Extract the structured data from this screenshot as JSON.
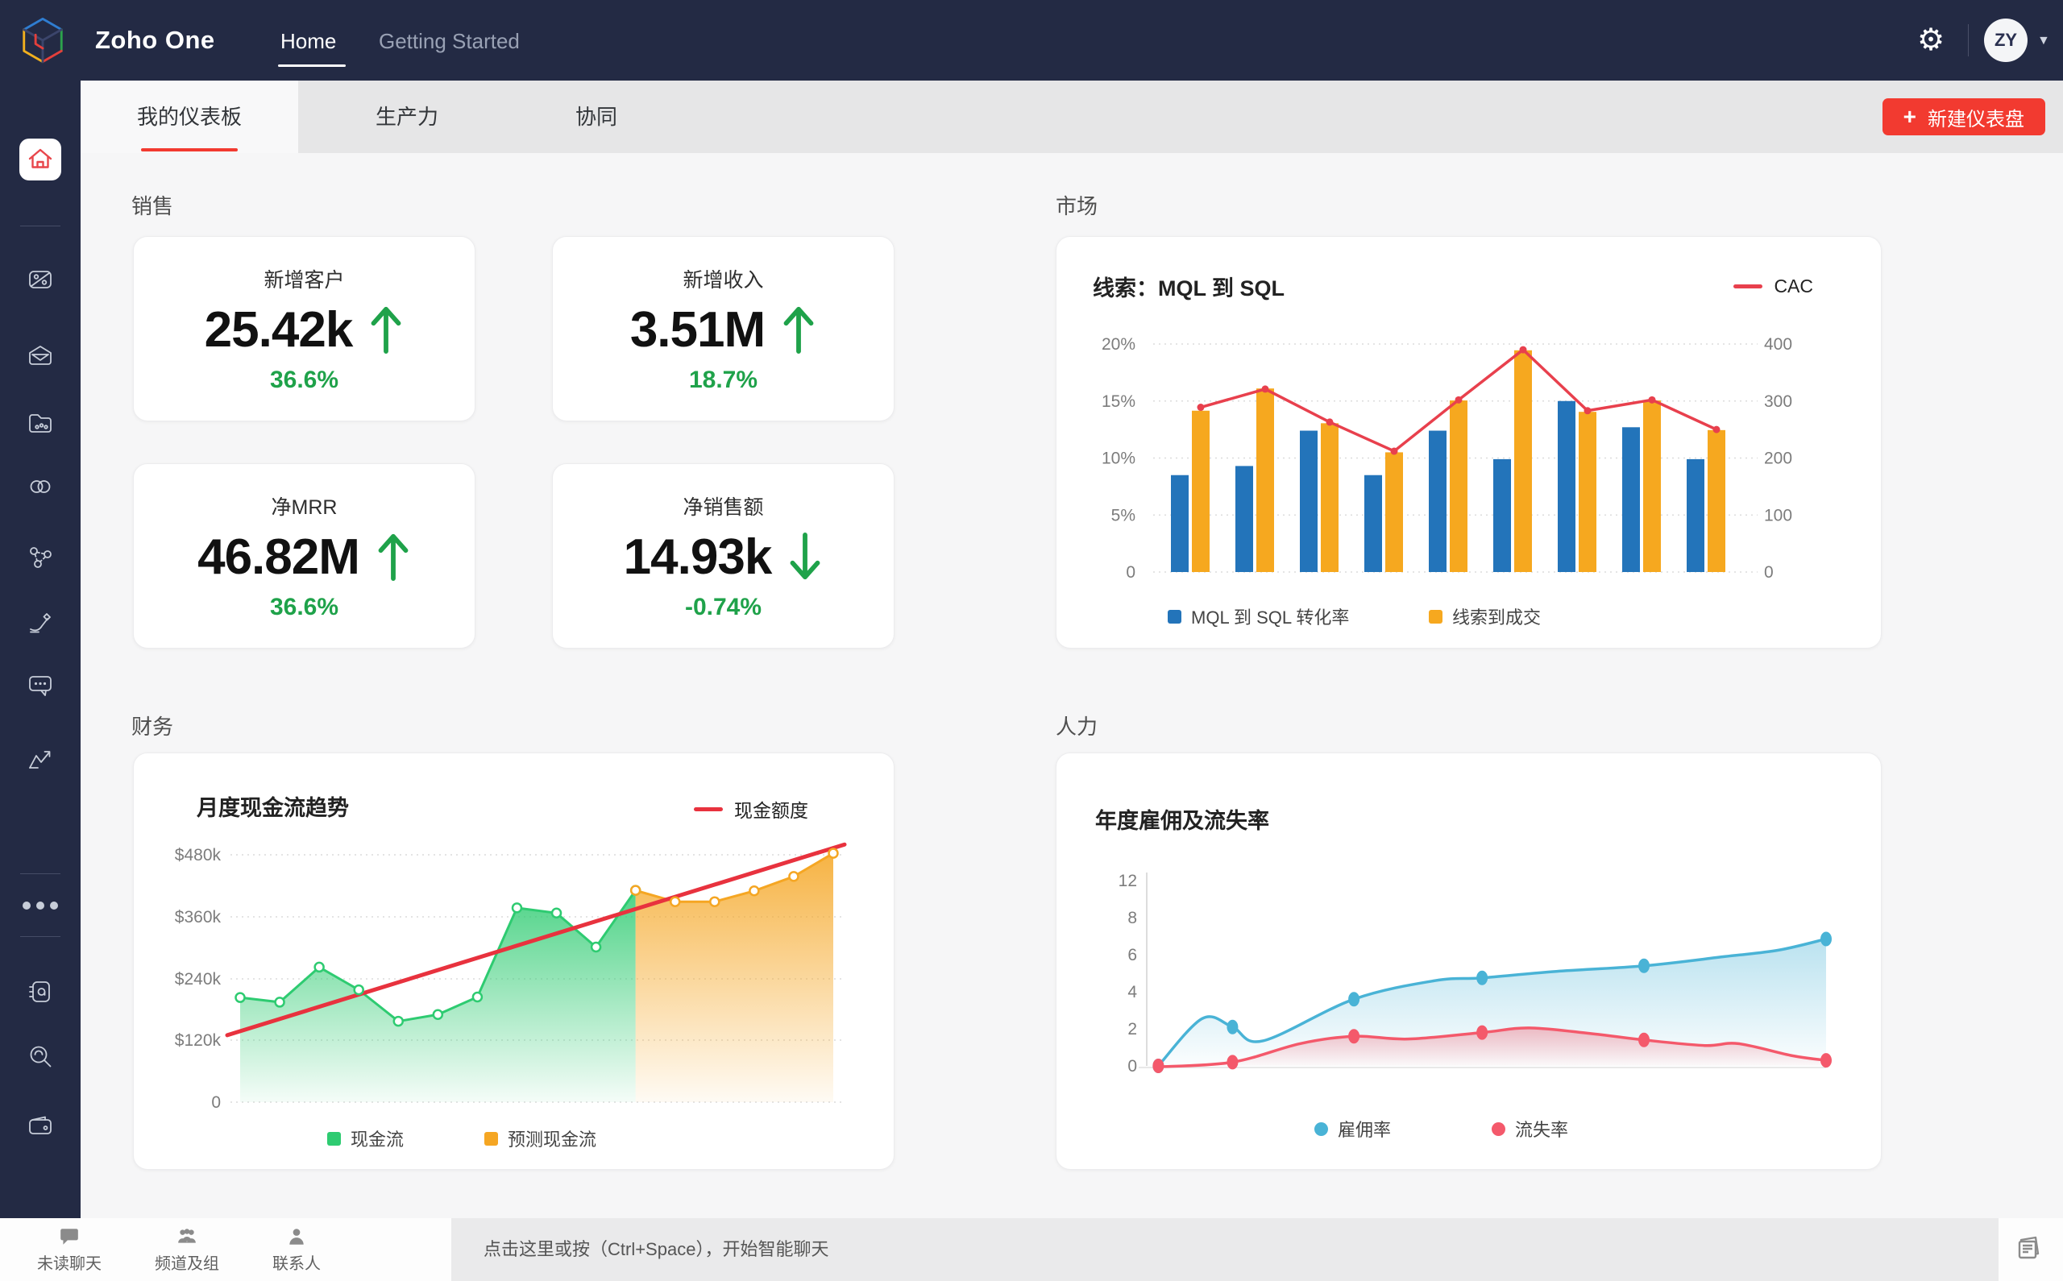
{
  "topbar": {
    "brand": "Zoho One",
    "nav": [
      {
        "label": "Home",
        "active": true
      },
      {
        "label": "Getting Started",
        "active": false
      }
    ],
    "avatar_initials": "ZY",
    "gear_icon": "gear-icon",
    "colors": {
      "bar_bg": "#232a44"
    }
  },
  "sidebar": {
    "items": [
      "home",
      "crm",
      "mail",
      "workdrive",
      "connections",
      "social",
      "sign",
      "cliq",
      "analytics",
      "more",
      "notebook",
      "search",
      "wallet"
    ]
  },
  "tabs": {
    "items": [
      "我的仪表板",
      "生产力",
      "协同"
    ],
    "active_index": 0,
    "new_button": {
      "plus": "+",
      "label": "新建仪表盘",
      "color": "#f23a30"
    }
  },
  "sections": {
    "sales": "销售",
    "market": "市场",
    "finance": "财务",
    "hr": "人力"
  },
  "kpis": [
    {
      "title": "新增客户",
      "value": "25.42k",
      "direction": "up",
      "change": "36.6%"
    },
    {
      "title": "新增收入",
      "value": "3.51M",
      "direction": "up",
      "change": "18.7%"
    },
    {
      "title": "净MRR",
      "value": "46.82M",
      "direction": "up",
      "change": "36.6%"
    },
    {
      "title": "净销售额",
      "value": "14.93k",
      "direction": "down",
      "change": "-0.74%"
    }
  ],
  "kpi_accent_color": "#1fa24a",
  "chart_data": [
    {
      "id": "market",
      "type": "bar",
      "title": "线索：MQL 到 SQL",
      "legend_line": "CAC",
      "left_axis": {
        "ticks": [
          "20%",
          "15%",
          "10%",
          "5%",
          "0"
        ],
        "max": 20
      },
      "right_axis": {
        "ticks": [
          "400",
          "300",
          "200",
          "100",
          "0"
        ],
        "max": 400
      },
      "grid": true,
      "legend_position": "bottom",
      "series": [
        {
          "name": "MQL 到 SQL 转化率",
          "type": "bar",
          "axis": "left",
          "color": "#2374ba",
          "values": [
            8.5,
            9.3,
            12.4,
            8.5,
            12.4,
            9.9,
            15.0,
            12.7,
            9.9
          ]
        },
        {
          "name": "线索到成交",
          "type": "bar",
          "axis": "right",
          "color": "#f6a81f",
          "values": [
            283,
            322,
            261,
            210,
            301,
            389,
            281,
            301,
            249
          ]
        },
        {
          "name": "CAC",
          "type": "line",
          "axis": "right",
          "color": "#e8404d",
          "values": [
            289,
            321,
            263,
            212,
            302,
            390,
            283,
            302,
            250
          ]
        }
      ]
    },
    {
      "id": "finance",
      "type": "area",
      "title": "月度现金流趋势",
      "legend_line": "现金额度",
      "y_ticks": [
        "$480k",
        "$360k",
        "$240k",
        "$120k",
        "0"
      ],
      "ylim": [
        0,
        520
      ],
      "grid": true,
      "legend_position": "bottom",
      "x_slots": 16,
      "series": [
        {
          "name": "现金流",
          "type": "area",
          "color": "#2ecb71",
          "x_start": 0,
          "values": [
            203,
            194,
            262,
            218,
            157,
            170,
            204,
            377,
            367,
            301,
            411
          ]
        },
        {
          "name": "预测现金流",
          "type": "area",
          "color": "#f5a623",
          "x_start": 10,
          "values": [
            411,
            389,
            389,
            410,
            438,
            483
          ]
        },
        {
          "name": "现金额度",
          "type": "trend",
          "color": "#e8323e",
          "start": 130,
          "end": 500
        }
      ]
    },
    {
      "id": "hr",
      "type": "line",
      "title": "年度雇佣及流失率",
      "y_ticks": [
        "12",
        "8",
        "6",
        "4",
        "2",
        "0"
      ],
      "grid": false,
      "legend_position": "bottom",
      "marker_x_fractions": [
        0.01,
        0.12,
        0.3,
        0.49,
        0.73,
        1.0
      ],
      "series": [
        {
          "name": "雇佣率",
          "color": "#49b3d6",
          "marker_values": [
            0,
            2.1,
            3.6,
            4.75,
            5.4,
            6.85
          ],
          "curve": [
            [
              0.01,
              0
            ],
            [
              0.075,
              2.55
            ],
            [
              0.12,
              2.1
            ],
            [
              0.165,
              1.35
            ],
            [
              0.3,
              3.6
            ],
            [
              0.42,
              4.6
            ],
            [
              0.49,
              4.75
            ],
            [
              0.6,
              5.1
            ],
            [
              0.73,
              5.4
            ],
            [
              0.85,
              5.9
            ],
            [
              0.93,
              6.25
            ],
            [
              1.0,
              6.85
            ]
          ]
        },
        {
          "name": "流失率",
          "color": "#f4596b",
          "marker_values": [
            0,
            0.2,
            1.6,
            1.8,
            1.4,
            0.3
          ],
          "curve": [
            [
              0.01,
              -0.05
            ],
            [
              0.12,
              0.2
            ],
            [
              0.22,
              1.2
            ],
            [
              0.3,
              1.6
            ],
            [
              0.38,
              1.45
            ],
            [
              0.49,
              1.8
            ],
            [
              0.56,
              2.05
            ],
            [
              0.65,
              1.75
            ],
            [
              0.73,
              1.4
            ],
            [
              0.82,
              1.1
            ],
            [
              0.87,
              1.2
            ],
            [
              0.95,
              0.55
            ],
            [
              1.0,
              0.3
            ]
          ]
        }
      ]
    }
  ],
  "bottombar": {
    "items": [
      {
        "label": "未读聊天",
        "icon": "chat-bubble-icon"
      },
      {
        "label": "频道及组",
        "icon": "group-icon"
      },
      {
        "label": "联系人",
        "icon": "contact-icon"
      }
    ],
    "prompt": "点击这里或按（Ctrl+Space），开始智能聊天",
    "docs_icon": "notes-icon"
  }
}
